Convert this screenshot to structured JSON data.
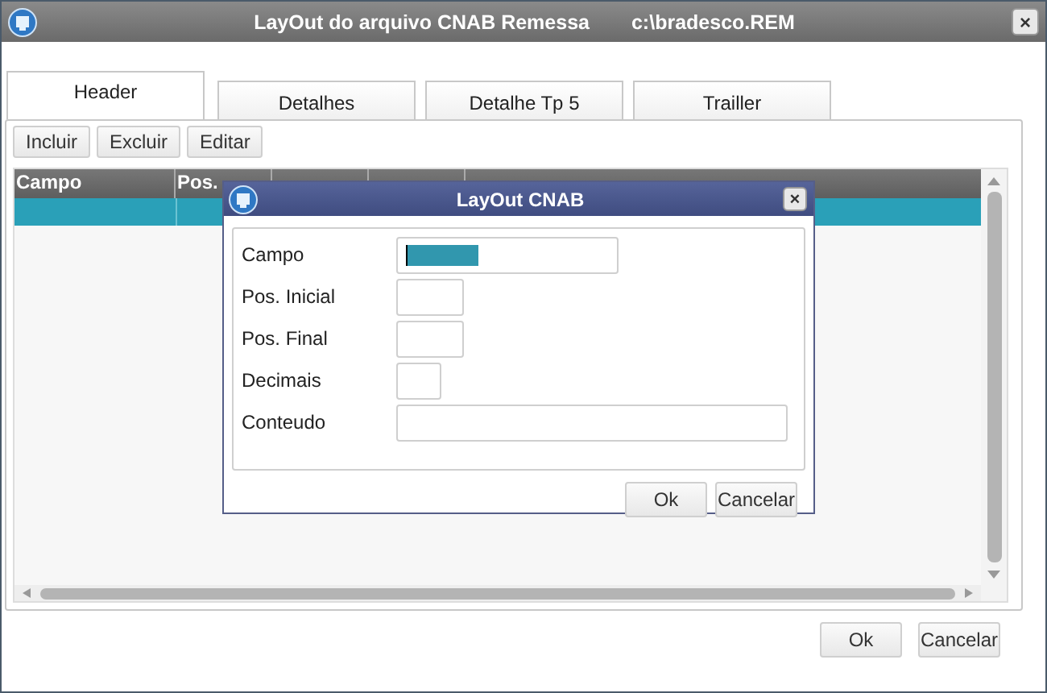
{
  "window": {
    "title": "LayOut do arquivo CNAB Remessa",
    "path": "c:\\bradesco.REM",
    "close": "×"
  },
  "tabs": [
    {
      "label": "Header",
      "selected": true
    },
    {
      "label": "Detalhes",
      "selected": false
    },
    {
      "label": "Detalhe Tp 5",
      "selected": false
    },
    {
      "label": "Trailler",
      "selected": false
    }
  ],
  "toolbar": [
    "Incluir",
    "Excluir",
    "Editar"
  ],
  "table": {
    "columns": [
      "Campo",
      "Pos."
    ],
    "rows": [
      {
        "selected": true
      }
    ]
  },
  "buttons": [
    "Ok",
    "Cancelar"
  ],
  "dialog": {
    "title": "LayOut CNAB",
    "close": "×",
    "fields": [
      {
        "label": "Campo",
        "kind": "wide",
        "focused": true
      },
      {
        "label": "Pos. Inicial",
        "kind": "small",
        "focused": false
      },
      {
        "label": "Pos. Final",
        "kind": "small",
        "focused": false
      },
      {
        "label": "Decimais",
        "kind": "tiny",
        "focused": false
      },
      {
        "label": "Conteudo",
        "kind": "full",
        "focused": false
      }
    ],
    "buttons": [
      "Ok",
      "Cancelar"
    ]
  }
}
